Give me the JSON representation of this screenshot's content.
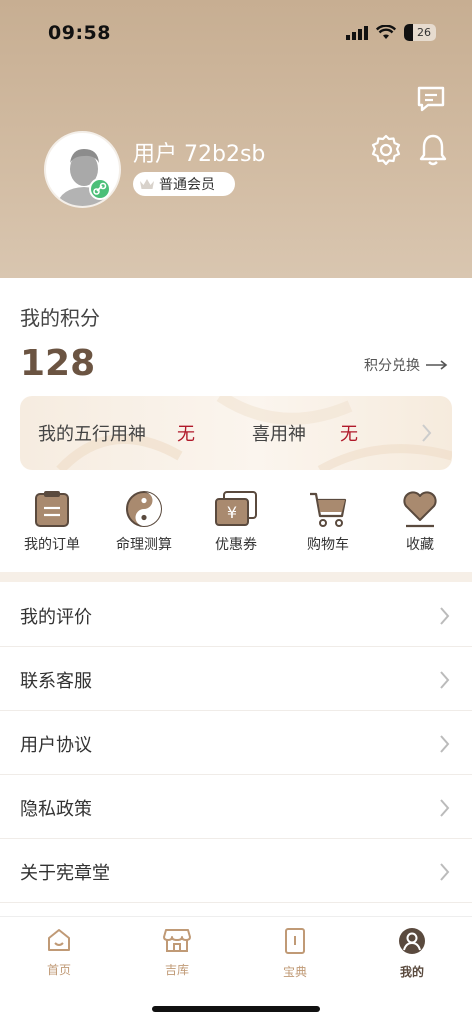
{
  "status": {
    "time": "09:58",
    "battery": "26"
  },
  "profile": {
    "username": "用户 72b2sb",
    "member_level": "普通会员"
  },
  "points": {
    "title": "我的积分",
    "value": "128",
    "exchange_label": "积分兑换"
  },
  "wuxing": {
    "label1": "我的五行用神",
    "value1": "无",
    "label2": "喜用神",
    "value2": "无"
  },
  "functions": [
    {
      "label": "我的订单",
      "icon": "order-icon"
    },
    {
      "label": "命理测算",
      "icon": "yinyang-icon"
    },
    {
      "label": "优惠券",
      "icon": "coupon-icon"
    },
    {
      "label": "购物车",
      "icon": "cart-icon"
    },
    {
      "label": "收藏",
      "icon": "heart-icon"
    }
  ],
  "menu": [
    {
      "label": "我的评价"
    },
    {
      "label": "联系客服"
    },
    {
      "label": "用户协议"
    },
    {
      "label": "隐私政策"
    },
    {
      "label": "关于宪章堂"
    }
  ],
  "tabs": [
    {
      "label": "首页",
      "icon": "home-icon"
    },
    {
      "label": "吉库",
      "icon": "shop-icon"
    },
    {
      "label": "宝典",
      "icon": "book-icon"
    },
    {
      "label": "我的",
      "icon": "user-icon",
      "active": true
    }
  ],
  "colors": {
    "header": "#c7ae92",
    "accent_text": "#6b5442",
    "value_red": "#b0192a",
    "tab_inactive": "#c09a76"
  }
}
